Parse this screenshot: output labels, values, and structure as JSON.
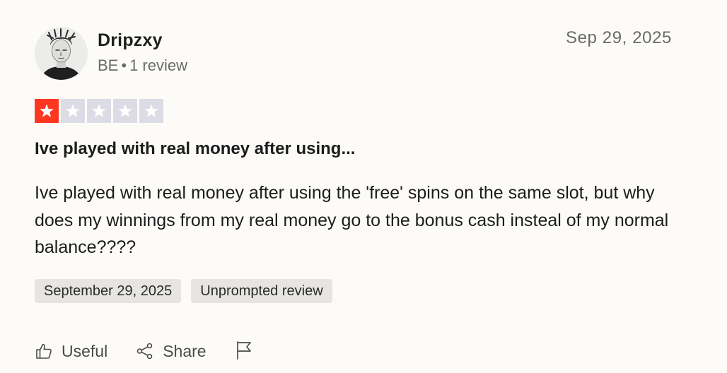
{
  "review": {
    "author": {
      "name": "Dripzxy",
      "country": "BE",
      "separator": "•",
      "review_count": "1 review",
      "avatar_icon": "user-avatar"
    },
    "date_short": "Sep 29, 2025",
    "rating": {
      "value": 1,
      "max": 5,
      "filled_color": "#ff3722",
      "empty_color": "#dcdce6"
    },
    "title": "Ive played with real money after using...",
    "body": "Ive played with real money after using the 'free' spins on the same slot, but why does my winnings from my real money go to the bonus cash insteal of my normal balance????",
    "tags": {
      "date": "September 29, 2025",
      "type": "Unprompted review"
    },
    "actions": {
      "useful_label": "Useful",
      "useful_icon": "thumbs-up-icon",
      "share_label": "Share",
      "share_icon": "share-icon",
      "report_icon": "flag-icon"
    }
  }
}
